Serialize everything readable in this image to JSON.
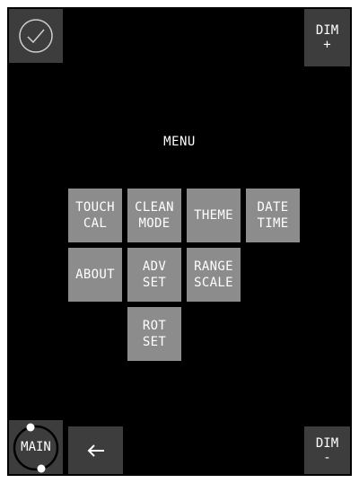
{
  "top_bar": {
    "confirm_icon": "check-circle-icon",
    "dim_plus": {
      "line1": "DIM",
      "line2": "+"
    }
  },
  "menu": {
    "title": "MENU",
    "buttons": [
      {
        "id": "touch-cal",
        "lines": [
          "TOUCH",
          "CAL"
        ]
      },
      {
        "id": "clean-mode",
        "lines": [
          "CLEAN",
          "MODE"
        ]
      },
      {
        "id": "theme",
        "lines": [
          "THEME"
        ]
      },
      {
        "id": "date-time",
        "lines": [
          "DATE",
          "TIME"
        ]
      },
      {
        "id": "about",
        "lines": [
          "ABOUT"
        ]
      },
      {
        "id": "adv-set",
        "lines": [
          "ADV",
          "SET"
        ]
      },
      {
        "id": "range-scale",
        "lines": [
          "RANGE",
          "SCALE"
        ]
      },
      {
        "id": "rot-set",
        "lines": [
          "ROT",
          "SET"
        ]
      }
    ]
  },
  "bottom_bar": {
    "main_label": "MAIN",
    "back_icon": "arrow-left-icon",
    "dim_minus": {
      "line1": "DIM",
      "line2": "-"
    }
  },
  "colors": {
    "screen_bg": "#000000",
    "corner_button_bg": "#3d3d3d",
    "menu_button_bg": "#8c8c8c",
    "text": "#ffffff"
  }
}
